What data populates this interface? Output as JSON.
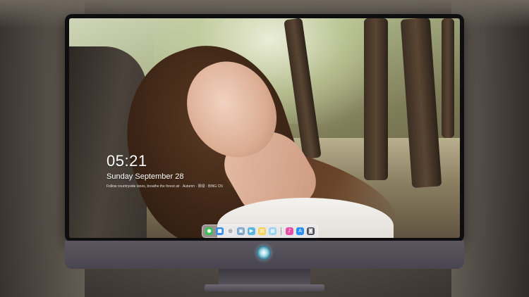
{
  "lock_screen": {
    "time": "05:21",
    "date": "Sunday September  28",
    "tagline": "Follow countryside lanes, breathe the forest air · Autumn · 翠绿 · BING CN"
  },
  "dock": {
    "icons": [
      {
        "name": "messages-icon",
        "color": "#3fbf5a",
        "glyph": "●"
      },
      {
        "name": "finder-icon",
        "color": "#3a8ee8",
        "glyph": "■"
      },
      {
        "name": "safari-icon",
        "color": "#e9ecef",
        "glyph": "◎"
      },
      {
        "name": "preview-icon",
        "color": "#7da6c9",
        "glyph": "▣"
      },
      {
        "name": "clapper-icon",
        "color": "#5bb7e0",
        "glyph": "▶"
      },
      {
        "name": "notes-icon",
        "color": "#f4d35e",
        "glyph": "▤"
      },
      {
        "name": "photos-icon",
        "color": "#9ad1ef",
        "glyph": "▦"
      },
      {
        "name": "itunes-icon",
        "color": "#e94fa7",
        "glyph": "♪"
      },
      {
        "name": "app-store-icon",
        "color": "#2d8ff0",
        "glyph": "A"
      },
      {
        "name": "camera-icon",
        "color": "#4a4a52",
        "glyph": "◙"
      }
    ]
  }
}
